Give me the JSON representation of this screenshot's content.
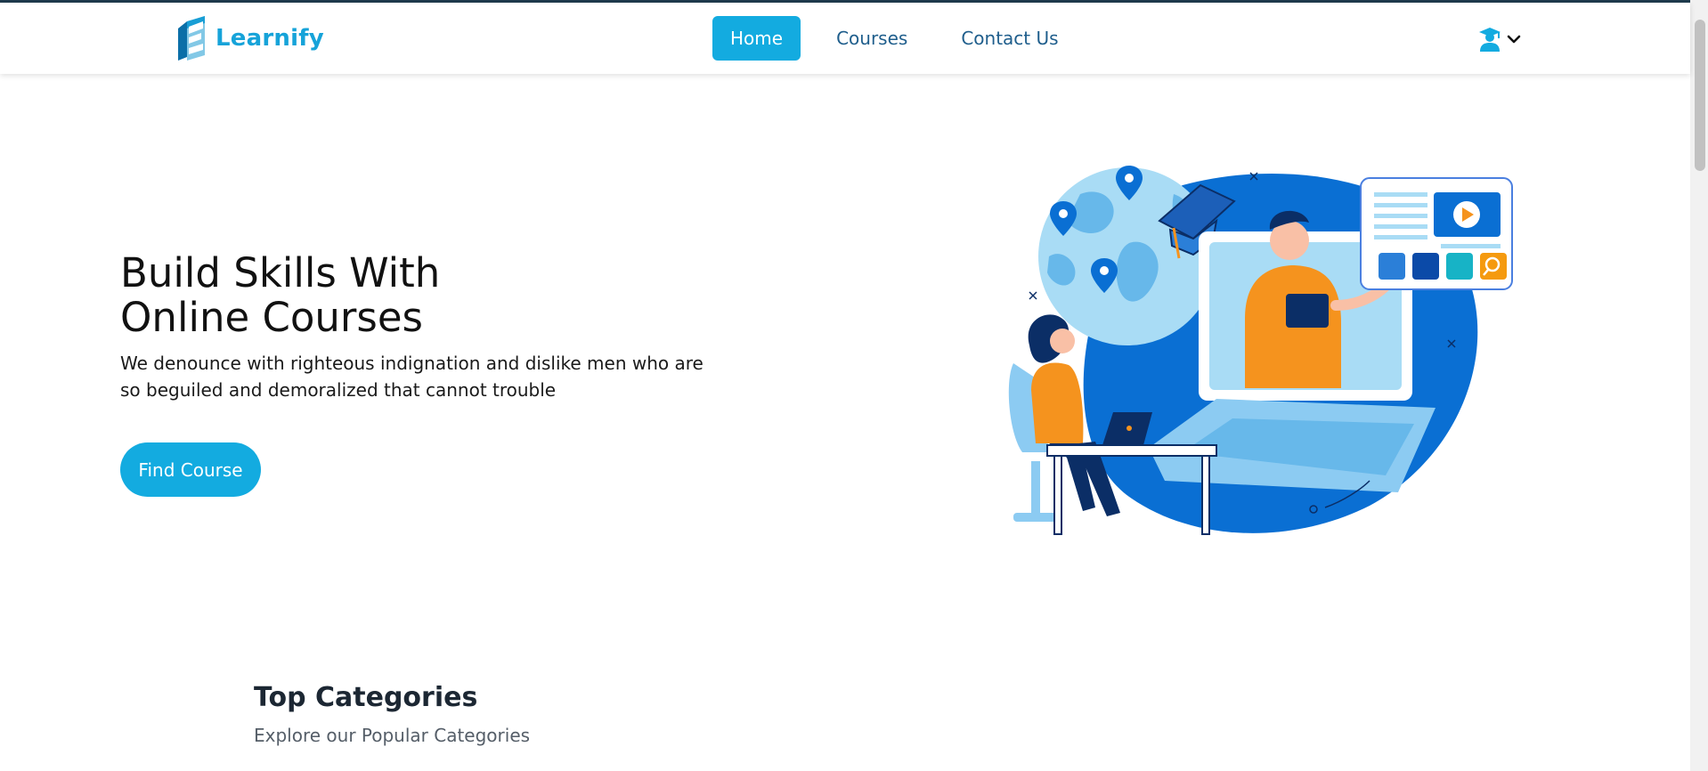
{
  "brand": {
    "name": "Learnify"
  },
  "nav": {
    "links": [
      {
        "label": "Home",
        "active": true
      },
      {
        "label": "Courses",
        "active": false
      },
      {
        "label": "Contact Us",
        "active": false
      }
    ],
    "user_menu": {
      "icon": "graduate-user-icon",
      "caret": "chevron-down-icon"
    }
  },
  "hero": {
    "title_line1": "Build Skills With",
    "title_line2": "Online Courses",
    "description": "We denounce with righteous indignation and dislike men who are so beguiled and demoralized that cannot trouble",
    "cta_label": "Find Course",
    "illustration": "online-learning-illustration"
  },
  "categories": {
    "title": "Top Categories",
    "subtitle": "Explore our Popular Categories"
  },
  "colors": {
    "brand": "#16a3d9",
    "accent": "#13abe0",
    "nav_text": "#1f5e8c",
    "illustration_blue": "#0a6fd3",
    "illustration_orange": "#f5931e"
  }
}
